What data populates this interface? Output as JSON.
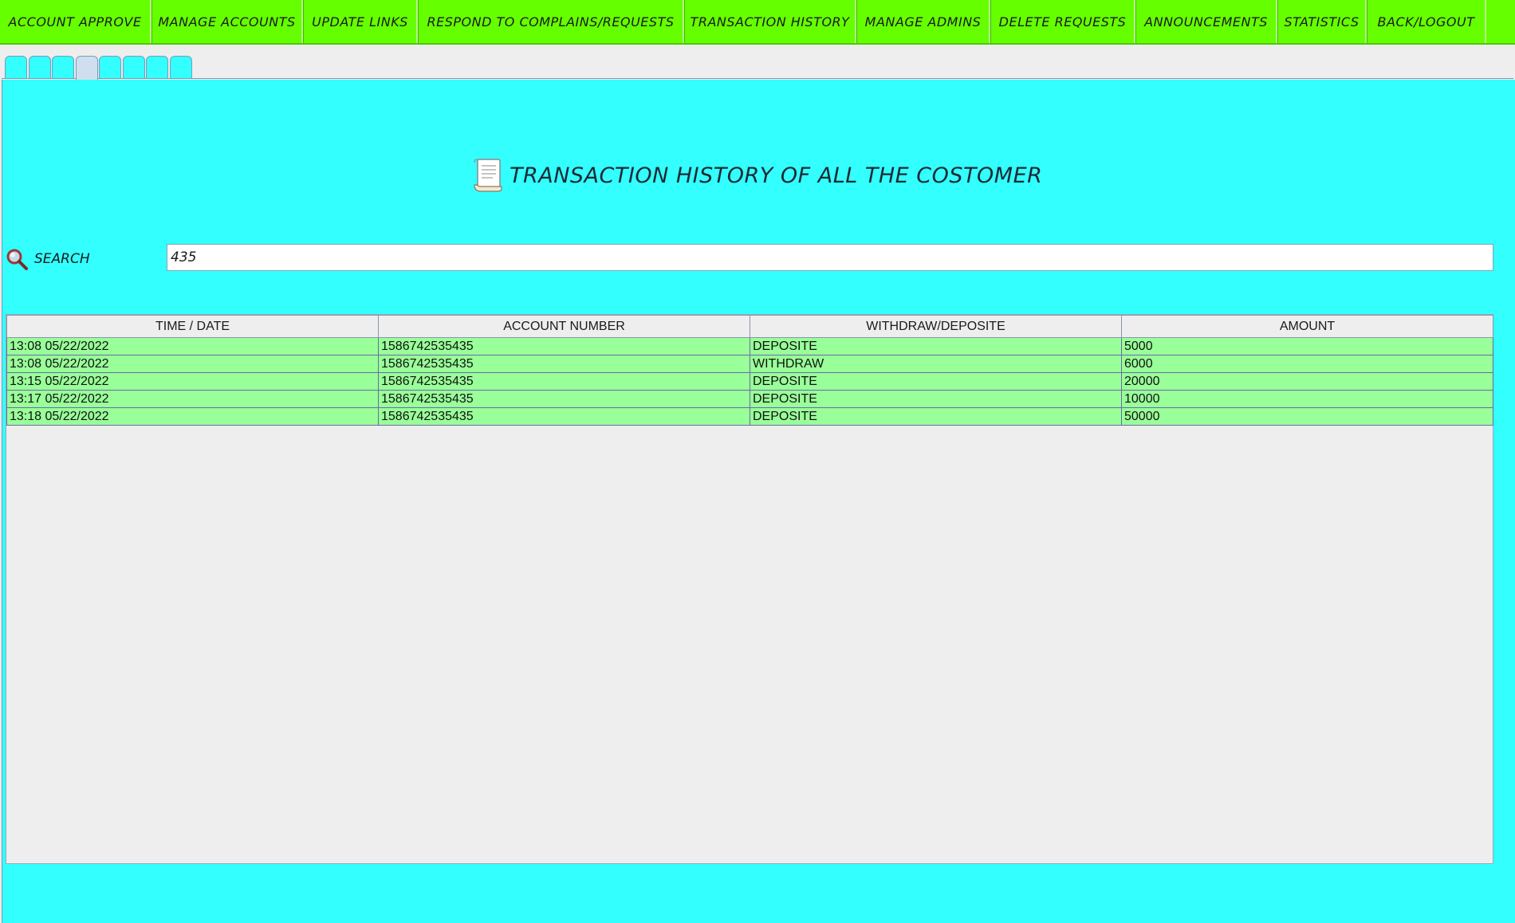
{
  "menu": [
    {
      "label": "ACCOUNT APPROVE",
      "name": "menu-account-approve"
    },
    {
      "label": "MANAGE ACCOUNTS",
      "name": "menu-manage-accounts"
    },
    {
      "label": "UPDATE LINKS",
      "name": "menu-update-links"
    },
    {
      "label": "RESPOND TO COMPLAINS/REQUESTS",
      "name": "menu-respond-complains"
    },
    {
      "label": "TRANSACTION HISTORY",
      "name": "menu-transaction-history"
    },
    {
      "label": "MANAGE ADMINS",
      "name": "menu-manage-admins"
    },
    {
      "label": "DELETE REQUESTS",
      "name": "menu-delete-requests"
    },
    {
      "label": "ANNOUNCEMENTS",
      "name": "menu-announcements"
    },
    {
      "label": "STATISTICS",
      "name": "menu-statistics"
    },
    {
      "label": "BACK/LOGOUT",
      "name": "menu-back-logout"
    }
  ],
  "tabs": {
    "count": 8,
    "active_index": 3
  },
  "page": {
    "title": "TRANSACTION HISTORY OF ALL THE COSTOMER",
    "title_icon": "receipt-icon"
  },
  "search": {
    "label": "SEARCH",
    "icon": "search-icon",
    "value": "435"
  },
  "table": {
    "columns": [
      "TIME / DATE",
      "ACCOUNT NUMBER",
      "WITHDRAW/DEPOSITE",
      "AMOUNT"
    ],
    "rows": [
      [
        "13:08 05/22/2022",
        "1586742535435",
        "DEPOSITE",
        "5000"
      ],
      [
        "13:08 05/22/2022",
        "1586742535435",
        "WITHDRAW",
        "6000"
      ],
      [
        "13:15 05/22/2022",
        "1586742535435",
        "DEPOSITE",
        "20000"
      ],
      [
        "13:17 05/22/2022",
        "1586742535435",
        "DEPOSITE",
        "10000"
      ],
      [
        "13:18 05/22/2022",
        "1586742535435",
        "DEPOSITE",
        "50000"
      ]
    ]
  },
  "colors": {
    "menu_bg": "#66ff00",
    "panel_bg": "#33ffff",
    "row_bg": "#99ff99"
  }
}
